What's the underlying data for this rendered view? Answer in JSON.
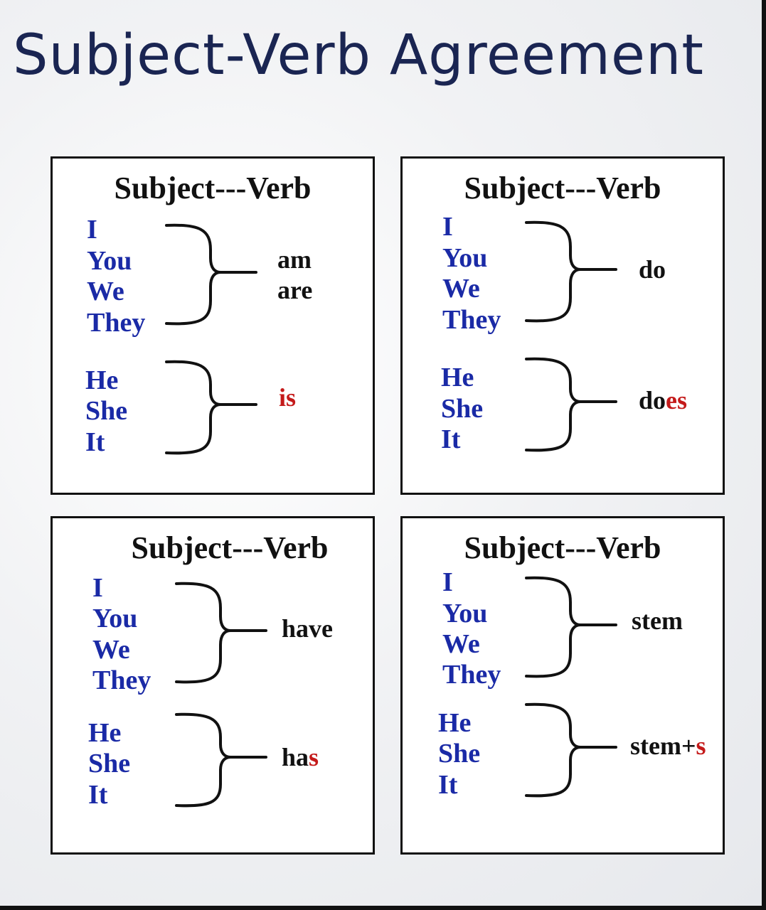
{
  "title": "Subject-Verb Agreement",
  "colors": {
    "subject": "#1a2aa6",
    "suffix": "#c41a1a",
    "title": "#1a2552"
  },
  "panels": [
    {
      "heading": "Subject---Verb",
      "plural_subjects": [
        "I",
        "You",
        "We",
        "They"
      ],
      "plural_verbs": [
        "am",
        "are"
      ],
      "singular_subjects": [
        "He",
        "She",
        "It"
      ],
      "singular_verb_stem": "",
      "singular_verb_suffix": "is"
    },
    {
      "heading": "Subject---Verb",
      "plural_subjects": [
        "I",
        "You",
        "We",
        "They"
      ],
      "plural_verbs": [
        "do"
      ],
      "singular_subjects": [
        "He",
        "She",
        "It"
      ],
      "singular_verb_stem": "do",
      "singular_verb_suffix": "es"
    },
    {
      "heading": "Subject---Verb",
      "plural_subjects": [
        "I",
        "You",
        "We",
        "They"
      ],
      "plural_verbs": [
        "have"
      ],
      "singular_subjects": [
        "He",
        "She",
        "It"
      ],
      "singular_verb_stem": "ha",
      "singular_verb_suffix": "s"
    },
    {
      "heading": "Subject---Verb",
      "plural_subjects": [
        "I",
        "You",
        "We",
        "They"
      ],
      "plural_verbs": [
        "stem"
      ],
      "singular_subjects": [
        "He",
        "She",
        "It"
      ],
      "singular_verb_stem": "stem+",
      "singular_verb_suffix": "s"
    }
  ]
}
